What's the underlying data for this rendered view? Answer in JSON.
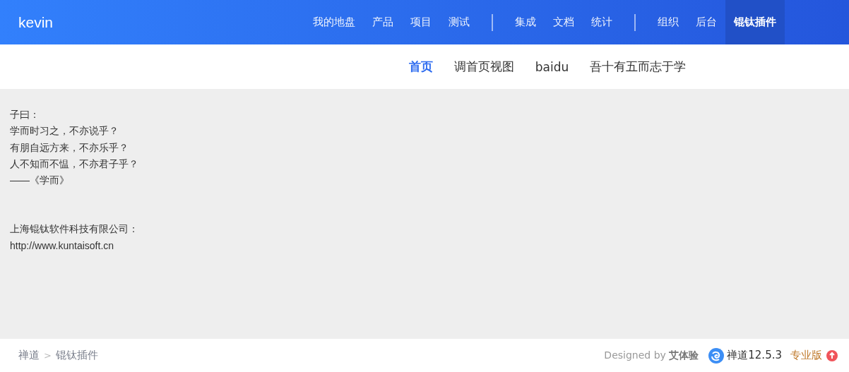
{
  "header": {
    "brand": "kevin",
    "nav_groups": [
      [
        {
          "label": "我的地盘",
          "selected": false
        },
        {
          "label": "产品",
          "selected": false
        },
        {
          "label": "项目",
          "selected": false
        },
        {
          "label": "测试",
          "selected": false
        }
      ],
      [
        {
          "label": "集成",
          "selected": false
        },
        {
          "label": "文档",
          "selected": false
        },
        {
          "label": "统计",
          "selected": false
        }
      ],
      [
        {
          "label": "组织",
          "selected": false
        },
        {
          "label": "后台",
          "selected": false
        },
        {
          "label": "锟钛插件",
          "selected": true
        }
      ]
    ]
  },
  "subnav": [
    {
      "label": "首页",
      "selected": true
    },
    {
      "label": "调首页视图",
      "selected": false
    },
    {
      "label": "baidu",
      "selected": false
    },
    {
      "label": "吾十有五而志于学",
      "selected": false
    }
  ],
  "content": {
    "paragraphs": [
      [
        "子曰：",
        "学而时习之，不亦说乎？",
        "有朋自远方来，不亦乐乎？",
        "人不知而不愠，不亦君子乎？",
        "——《学而》"
      ],
      [
        "上海锟钛软件科技有限公司：",
        "http://www.kuntaisoft.cn"
      ]
    ]
  },
  "footer": {
    "breadcrumb": [
      "禅道",
      "锟钛插件"
    ],
    "separator": ">",
    "designed_by": "Designed by **艾体验**",
    "version": "禅道12.5.3",
    "edition": "专业版"
  }
}
